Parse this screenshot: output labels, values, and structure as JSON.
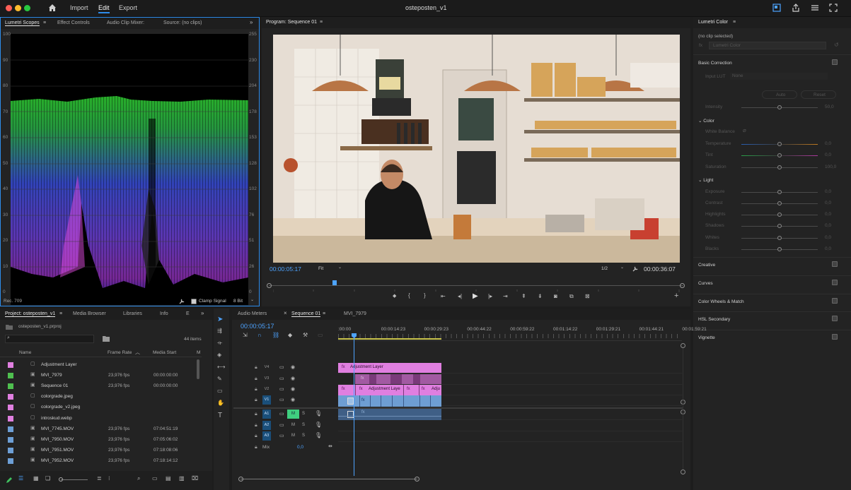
{
  "app": {
    "title": "osteposten_v1",
    "menu": [
      "Import",
      "Edit",
      "Export"
    ]
  },
  "scopes_panel": {
    "tabs": [
      "Lumetri Scopes",
      "Effect Controls",
      "Audio Clip Mixer:",
      "Source: (no clips)"
    ],
    "left_axis": [
      "100",
      "90",
      "80",
      "70",
      "60",
      "50",
      "40",
      "30",
      "20",
      "10",
      "0"
    ],
    "right_axis": [
      "255",
      "230",
      "204",
      "178",
      "153",
      "128",
      "102",
      "76",
      "51",
      "26",
      "0"
    ],
    "color_space": "Rec. 709",
    "clamp_label": "Clamp Signal",
    "bit_depth": "8 Bit"
  },
  "program_panel": {
    "title": "Program: Sequence 01",
    "timecode": "00:00:05:17",
    "fit": "Fit",
    "resolution": "1/2",
    "duration": "00:00:36:07",
    "playhead_fraction": 0.158
  },
  "lumetri": {
    "title": "Lumetri Color",
    "no_clip": "(no clip selected)",
    "fx_dropdown": "Lumetri Color",
    "basic_correction": "Basic Correction",
    "input_lut_label": "Input LUT",
    "input_lut_value": "None",
    "auto": "Auto",
    "reset": "Reset",
    "intensity": {
      "label": "Intensity",
      "value": "50,0"
    },
    "color_section": "Color",
    "white_balance": "White Balance",
    "color_rows": [
      {
        "label": "Temperature",
        "value": "0,0"
      },
      {
        "label": "Tint",
        "value": "0,0"
      },
      {
        "label": "Saturation",
        "value": "100,0"
      }
    ],
    "light_section": "Light",
    "light_rows": [
      {
        "label": "Exposure",
        "value": "0,0"
      },
      {
        "label": "Contrast",
        "value": "0,0"
      },
      {
        "label": "Highlights",
        "value": "0,0"
      },
      {
        "label": "Shadows",
        "value": "0,0"
      },
      {
        "label": "Whites",
        "value": "0,0"
      },
      {
        "label": "Blacks",
        "value": "0,0"
      }
    ],
    "sections": [
      "Creative",
      "Curves",
      "Color Wheels & Match",
      "HSL Secondary",
      "Vignette"
    ]
  },
  "project_panel": {
    "tabs": [
      "Project: osteposten_v1",
      "Media Browser",
      "Libraries",
      "Info",
      "E"
    ],
    "project_file": "osteposten_v1.prproj",
    "item_count": "44 items",
    "columns": [
      "Name",
      "Frame Rate",
      "Media Start",
      "M"
    ],
    "items": [
      {
        "name": "Adjustment Layer",
        "fps": "",
        "start": "",
        "color": "#e07fe0"
      },
      {
        "name": "MVI_7979",
        "fps": "23,976 fps",
        "start": "00:00:00:00",
        "color": "#4fbf4f"
      },
      {
        "name": "Sequence 01",
        "fps": "23,976 fps",
        "start": "00:00:00:00",
        "color": "#4fbf4f"
      },
      {
        "name": "colorgrade.jpeg",
        "fps": "",
        "start": "",
        "color": "#e07fe0"
      },
      {
        "name": "colorgrade_v2.jpeg",
        "fps": "",
        "start": "",
        "color": "#e07fe0"
      },
      {
        "name": "introskud.webp",
        "fps": "",
        "start": "",
        "color": "#e07fe0"
      },
      {
        "name": "MVI_7745.MOV",
        "fps": "23,976 fps",
        "start": "07:04:51:19",
        "color": "#6d9fd6"
      },
      {
        "name": "MVI_7950.MOV",
        "fps": "23,976 fps",
        "start": "07:05:06:02",
        "color": "#6d9fd6"
      },
      {
        "name": "MVI_7951.MOV",
        "fps": "23,976 fps",
        "start": "07:18:08:06",
        "color": "#6d9fd6"
      },
      {
        "name": "MVI_7952.MOV",
        "fps": "23,976 fps",
        "start": "07:18:14:12",
        "color": "#6d9fd6"
      }
    ]
  },
  "timeline": {
    "tabs": [
      "Audio Meters",
      "Sequence 01",
      "MVI_7979"
    ],
    "timecode": "00:00:05:17",
    "ruler": [
      ":00:00",
      "00:00:14:23",
      "00:00:29:23",
      "00:00:44:22",
      "00:00:59:22",
      "00:01:14:22",
      "00:01:29:21",
      "00:01:44:21",
      "00:01:59:21"
    ],
    "video_tracks": [
      "V4",
      "V3",
      "V2",
      "V1"
    ],
    "audio_tracks": [
      "A1",
      "A2",
      "A3"
    ],
    "mix_label": "Mix",
    "mix_value": "0,0",
    "m": "M",
    "s": "S",
    "clips": {
      "adjustment_top": "Adjustment Layer",
      "adjustment_v2": "Adjustment Laye",
      "adjustment_v2b": "Adju",
      "fx": "fx"
    }
  },
  "colors": {
    "accent": "#2d8ceb",
    "clip_pink": "#e07fe0",
    "clip_blue": "#6e9ed3",
    "playhead": "#4da3ff"
  }
}
